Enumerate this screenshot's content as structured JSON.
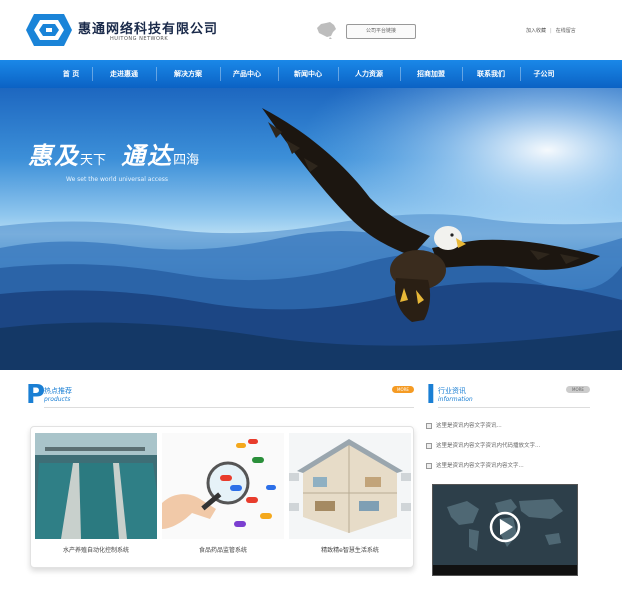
{
  "header": {
    "company_name": "惠通网络科技有限公司",
    "company_sub": "HUITONG NETWORK",
    "search_placeholder": "公司平台链接",
    "link_favorite": "加入收藏",
    "link_message": "在线留言"
  },
  "nav": {
    "items": [
      {
        "label": "首 页"
      },
      {
        "label": "走进惠通"
      },
      {
        "label": "解决方案"
      },
      {
        "label": "产品中心"
      },
      {
        "label": "新闻中心"
      },
      {
        "label": "人力资源"
      },
      {
        "label": "招商加盟"
      },
      {
        "label": "联系我们"
      },
      {
        "label": "子公司"
      }
    ]
  },
  "banner": {
    "slogan_1_big": "惠及",
    "slogan_1_small": "天下",
    "slogan_2_big": "通达",
    "slogan_2_small": "四海",
    "slogan_en": "We set the world universal access"
  },
  "products": {
    "letter": "P",
    "title_cn": "热点推荐",
    "title_en": "products",
    "more": "MORE",
    "items": [
      {
        "label": "水产养殖自动化控制系统"
      },
      {
        "label": "食品药品监管系统"
      },
      {
        "label": "精致精e智慧生活系统"
      }
    ]
  },
  "news": {
    "letter": "I",
    "title_cn": "行业资讯",
    "title_en": "information",
    "more": "MORE",
    "items": [
      {
        "text": "这里是资讯内容文字资讯..."
      },
      {
        "text": "这里是资讯内容文字资讯内代码播放文字..."
      },
      {
        "text": "这里是资讯内容文字资讯内容文字..."
      }
    ]
  },
  "colors": {
    "brand_blue": "#1a7fd4",
    "nav_top": "#1a88e8",
    "nav_bottom": "#0b62c4",
    "accent_orange": "#f59b24"
  }
}
